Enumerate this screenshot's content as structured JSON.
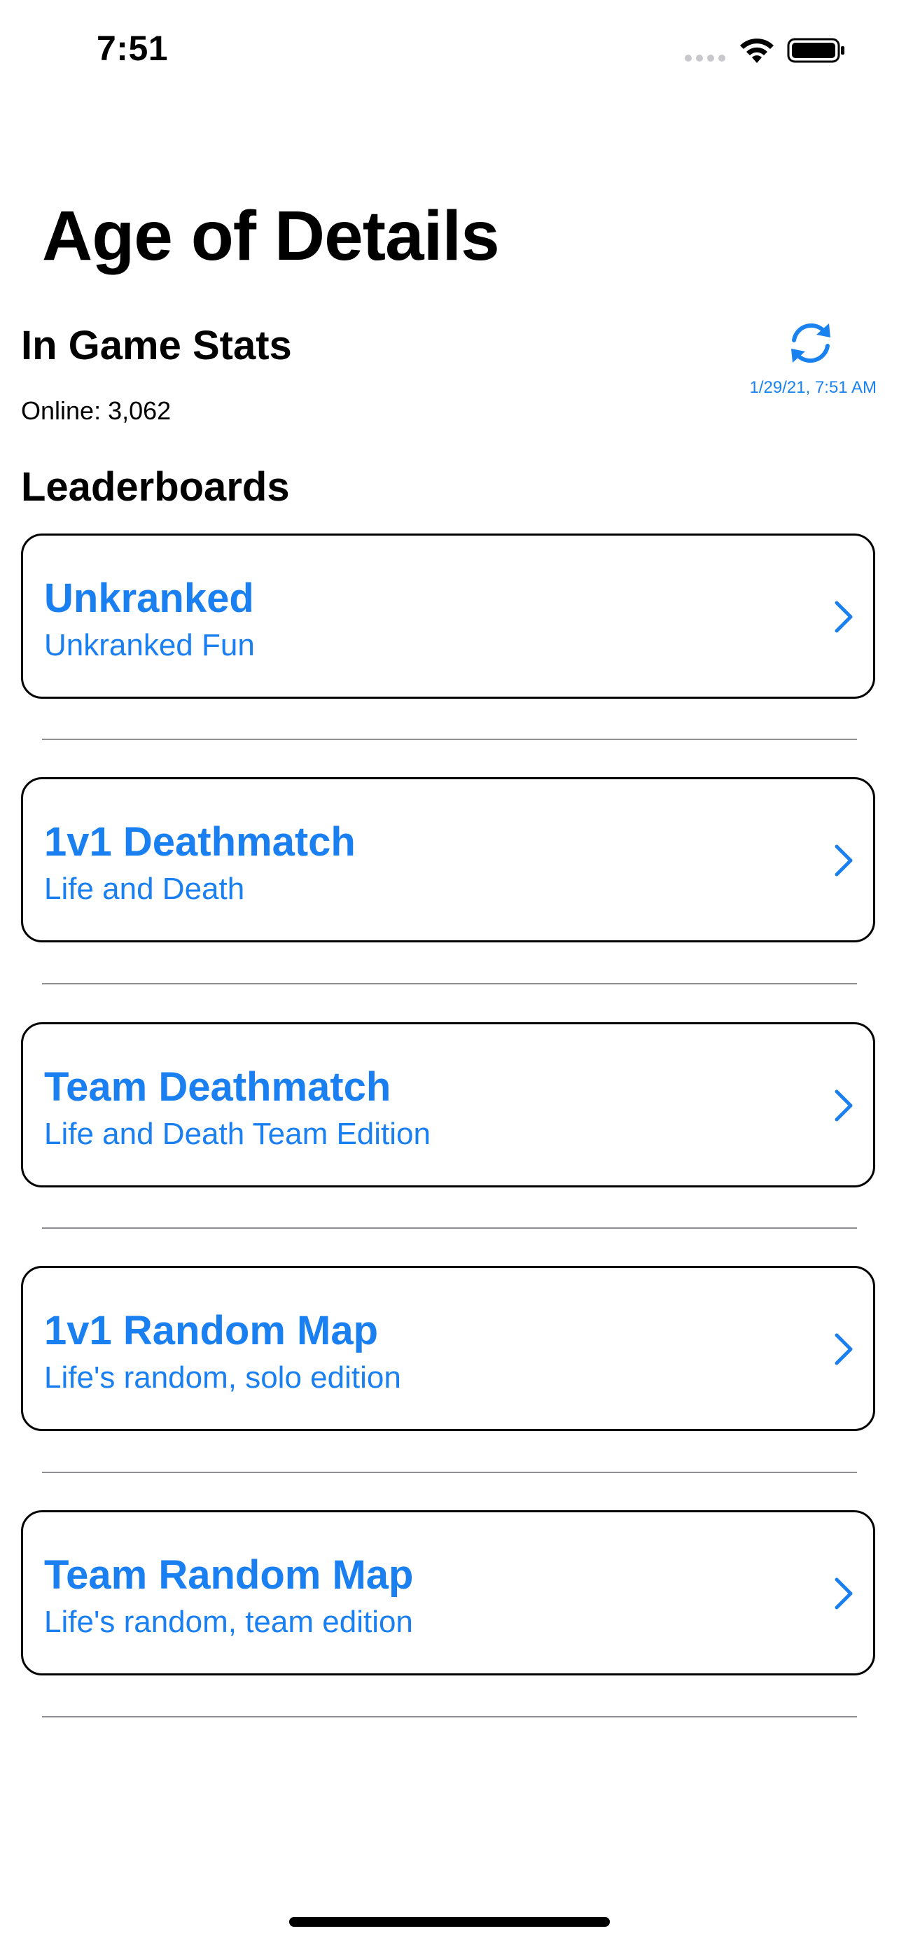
{
  "status_bar": {
    "time": "7:51"
  },
  "page": {
    "title": "Age of Details"
  },
  "stats": {
    "title": "In Game Stats",
    "online_label": "Online:",
    "online_count": "3,062",
    "refresh_icon": "refresh-icon",
    "last_updated": "1/29/21, 7:51 AM"
  },
  "leaderboards": {
    "title": "Leaderboards",
    "items": [
      {
        "name": "Unkranked",
        "subtitle": "Unkranked Fun"
      },
      {
        "name": "1v1 Deathmatch",
        "subtitle": "Life and Death"
      },
      {
        "name": "Team Deathmatch",
        "subtitle": "Life and Death Team Edition"
      },
      {
        "name": "1v1 Random Map",
        "subtitle": "Life's random, solo edition"
      },
      {
        "name": "Team Random Map",
        "subtitle": "Life's random, team edition"
      }
    ]
  },
  "colors": {
    "accent": "#1a7ff0",
    "text": "#000000",
    "background": "#ffffff",
    "separator": "#8e8e93"
  }
}
